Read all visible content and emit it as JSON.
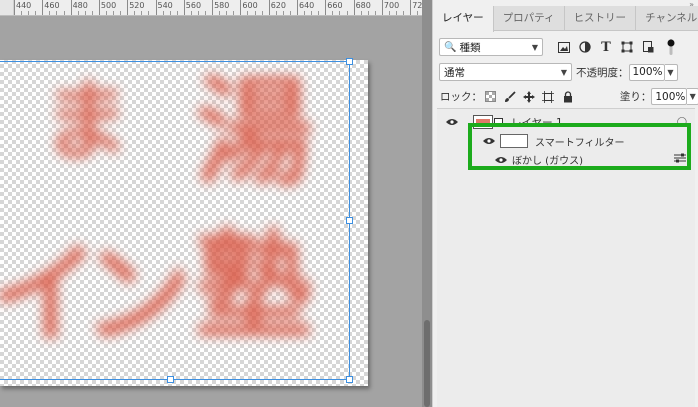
{
  "ruler": {
    "labels": [
      "440",
      "460",
      "480",
      "500",
      "520",
      "540",
      "560",
      "580",
      "600",
      "620",
      "640",
      "660",
      "680",
      "700",
      "72"
    ]
  },
  "canvas": {
    "chars": [
      "ま",
      "湯",
      "イ",
      "ン",
      "塾"
    ],
    "char_color": "#d9533f",
    "selection_color": "#3d8fe0"
  },
  "tabs": [
    {
      "label": "レイヤー",
      "active": true
    },
    {
      "label": "プロパティ",
      "active": false
    },
    {
      "label": "ヒストリー",
      "active": false
    },
    {
      "label": "チャンネル",
      "active": false
    }
  ],
  "filter": {
    "kind_label": "種類",
    "icons": [
      "image-filter-icon",
      "adjustment-filter-icon",
      "type-filter-icon",
      "shape-filter-icon",
      "smart-object-filter-icon",
      "filter-toggle-icon"
    ]
  },
  "blend": {
    "mode": "通常",
    "opacity_label": "不透明度：",
    "opacity_value": "100%"
  },
  "lock": {
    "label": "ロック：",
    "fill_label": "塗り：",
    "fill_value": "100%"
  },
  "layers": {
    "layer_name": "レイヤー 1",
    "smart_filter_label": "スマートフィルター",
    "filter_name": "ぼかし (ガウス)"
  },
  "colors": {
    "highlight": "#1cab1c",
    "panel_bg": "#f0f0f0"
  }
}
